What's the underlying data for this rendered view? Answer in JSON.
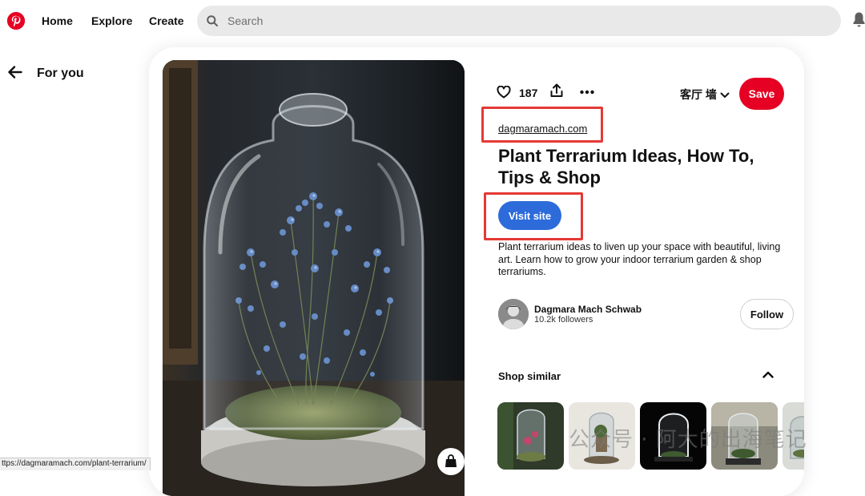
{
  "header": {
    "nav": {
      "home": "Home",
      "explore": "Explore",
      "create": "Create"
    },
    "search": {
      "placeholder": "Search"
    }
  },
  "back": {
    "label": "For you"
  },
  "pin": {
    "likes": "187",
    "board": "客厅 墙",
    "save_label": "Save",
    "source": "dagmaramach.com",
    "title": "Plant Terrarium Ideas, How To, Tips & Shop",
    "visit_label": "Visit site",
    "description": "Plant terrarium ideas to liven up your space with beautiful, living art. Learn how to grow your indoor terrarium garden & shop terrariums."
  },
  "creator": {
    "name": "Dagmara Mach Schwab",
    "followers": "10.2k followers",
    "follow_label": "Follow"
  },
  "shop": {
    "header": "Shop similar"
  },
  "status_url": "ttps://dagmaramach.com/plant-terrarium/",
  "watermark": "公众号 · 阿大的出海笔记",
  "colors": {
    "brand": "#e60023",
    "visit": "#2d6bdb",
    "annotation": "#e53935"
  }
}
